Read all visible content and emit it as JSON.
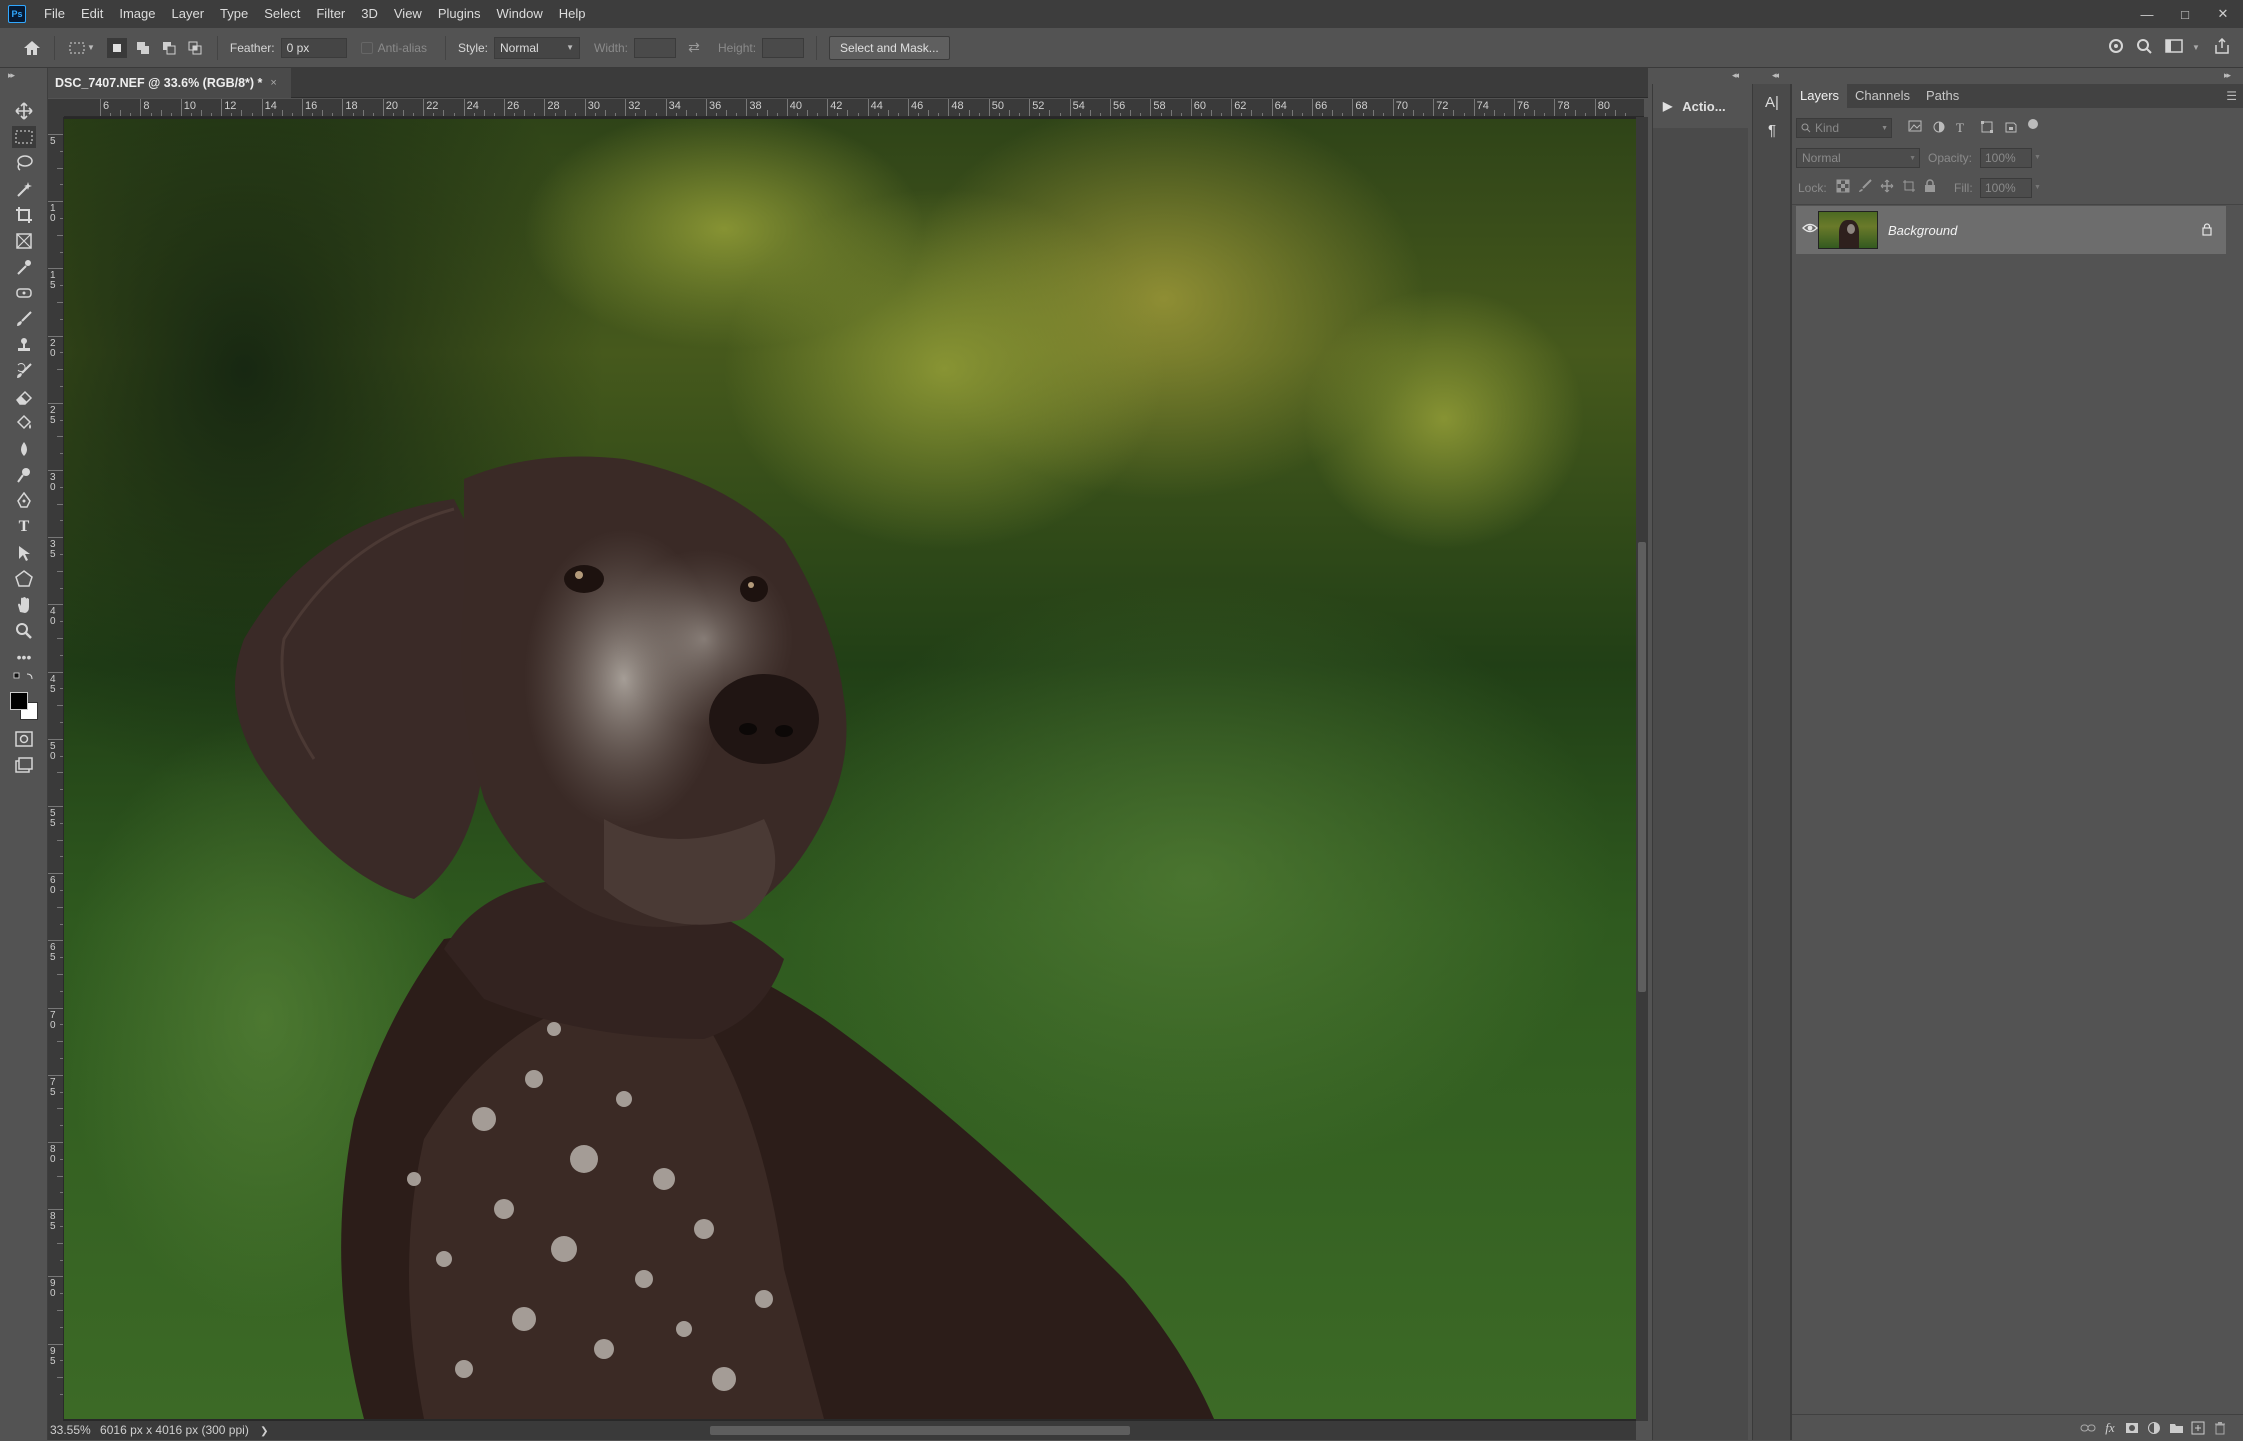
{
  "menubar": {
    "logo": "Ps",
    "items": [
      "File",
      "Edit",
      "Image",
      "Layer",
      "Type",
      "Select",
      "Filter",
      "3D",
      "View",
      "Plugins",
      "Window",
      "Help"
    ]
  },
  "options": {
    "feather_label": "Feather:",
    "feather_value": "0 px",
    "antialias_label": "Anti-alias",
    "style_label": "Style:",
    "style_value": "Normal",
    "width_label": "Width:",
    "height_label": "Height:",
    "select_mask_label": "Select and Mask..."
  },
  "document": {
    "tab_title": "DSC_7407.NEF @ 33.6% (RGB/8*) *",
    "tab_close": "×"
  },
  "ruler": {
    "h_ticks": [
      "6",
      "8",
      "10",
      "12",
      "14",
      "16",
      "18",
      "20",
      "22",
      "24",
      "26",
      "28",
      "30",
      "32",
      "34",
      "36",
      "38",
      "40",
      "42",
      "44",
      "46",
      "48",
      "50",
      "52",
      "54",
      "56",
      "58",
      "60",
      "62",
      "64",
      "66",
      "68",
      "70",
      "72",
      "74",
      "76",
      "78",
      "80"
    ],
    "v_ticks": [
      "5",
      "10",
      "15",
      "20",
      "25",
      "30",
      "35",
      "40",
      "45",
      "50",
      "55",
      "60",
      "65",
      "70",
      "75",
      "80",
      "85",
      "90",
      "95"
    ]
  },
  "statusbar": {
    "zoom": "33.55%",
    "info": "6016 px x 4016 px (300 ppi)"
  },
  "actions_panel": {
    "label": "Actio..."
  },
  "layers_panel": {
    "tabs": [
      "Layers",
      "Channels",
      "Paths"
    ],
    "kind_placeholder": "Kind",
    "blend_mode": "Normal",
    "opacity_label": "Opacity:",
    "opacity_value": "100%",
    "lock_label": "Lock:",
    "fill_label": "Fill:",
    "fill_value": "100%",
    "layers": [
      {
        "name": "Background",
        "visible": true,
        "locked": true
      }
    ]
  },
  "colors": {
    "accent": "#31a8ff",
    "panel_bg": "#535353",
    "dark_bg": "#3a3a3a"
  }
}
